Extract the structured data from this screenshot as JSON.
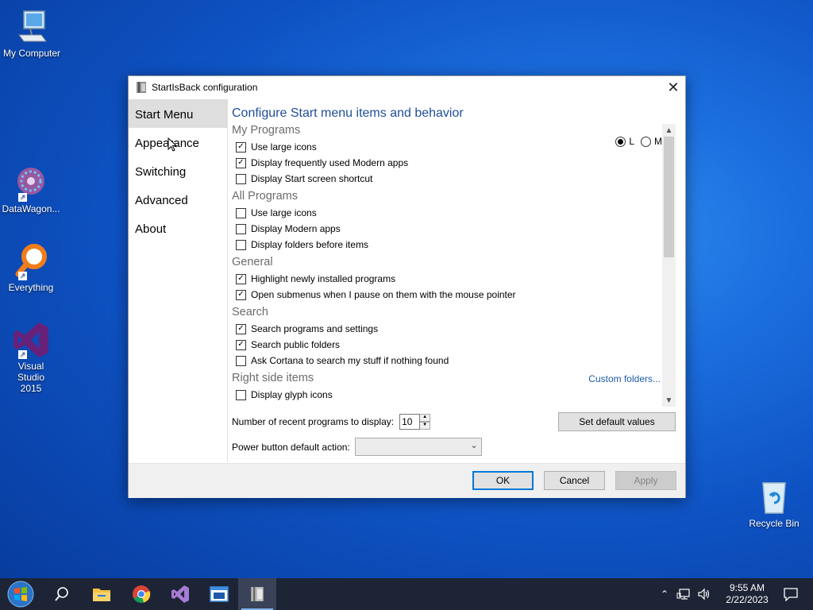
{
  "desktop": {
    "icons": [
      {
        "label": "My Computer"
      },
      {
        "label": "DataWagon..."
      },
      {
        "label": "Everything"
      },
      {
        "label": "Visual Studio 2015"
      },
      {
        "label": "Recycle Bin"
      }
    ]
  },
  "dialog": {
    "title": "StartIsBack configuration",
    "close_glyph": "✕",
    "nav": [
      "Start Menu",
      "Appearance",
      "Switching",
      "Advanced",
      "About"
    ],
    "heading": "Configure Start menu items and behavior",
    "groups": {
      "my_programs": {
        "title": "My Programs",
        "items": [
          {
            "label": "Use large icons",
            "checked": true
          },
          {
            "label": "Display frequently used Modern apps",
            "checked": true
          },
          {
            "label": "Display Start screen shortcut",
            "checked": false
          }
        ]
      },
      "all_programs": {
        "title": "All Programs",
        "items": [
          {
            "label": "Use large icons",
            "checked": false
          },
          {
            "label": "Display Modern apps",
            "checked": false
          },
          {
            "label": "Display folders before items",
            "checked": false
          }
        ]
      },
      "general": {
        "title": "General",
        "items": [
          {
            "label": "Highlight newly installed programs",
            "checked": true
          },
          {
            "label": "Open submenus when I pause on them with the mouse pointer",
            "checked": true
          }
        ]
      },
      "search": {
        "title": "Search",
        "items": [
          {
            "label": "Search programs and settings",
            "checked": true
          },
          {
            "label": "Search public folders",
            "checked": true
          },
          {
            "label": "Ask Cortana to search my stuff if nothing found",
            "checked": false
          }
        ]
      },
      "right_side": {
        "title": "Right side items",
        "link": "Custom folders...",
        "items": [
          {
            "label": "Display glyph icons",
            "checked": false
          }
        ]
      }
    },
    "size_radio": {
      "l": "L",
      "m": "M",
      "selected": "L"
    },
    "recent_label": "Number of recent programs to display:",
    "recent_value": "10",
    "default_button": "Set default values",
    "power_label": "Power button default action:",
    "power_value": "",
    "buttons": {
      "ok": "OK",
      "cancel": "Cancel",
      "apply": "Apply"
    }
  },
  "taskbar": {
    "apps": [
      "start",
      "search",
      "file-explorer",
      "chrome",
      "visual-studio",
      "window-app",
      "startisback-config"
    ],
    "time": "9:55 AM",
    "date": "2/22/2023"
  },
  "colors": {
    "accent": "#0078d7",
    "heading": "#1f4e96",
    "link": "#1f5aa8",
    "taskbar": "#1d2435"
  }
}
